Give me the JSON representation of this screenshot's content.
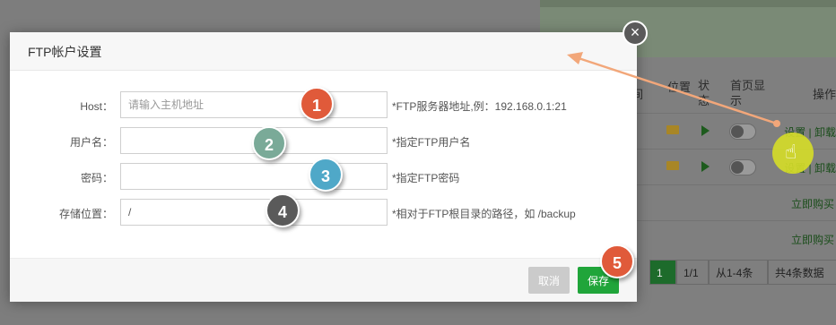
{
  "modal": {
    "title": "FTP帐户设置",
    "fields": [
      {
        "label": "Host：",
        "value": "",
        "placeholder": "请输入主机地址",
        "hint": "*FTP服务器地址,例：192.168.0.1:21"
      },
      {
        "label": "用户名：",
        "value": "",
        "placeholder": "",
        "hint": "*指定FTP用户名"
      },
      {
        "label": "密码：",
        "value": "",
        "placeholder": "",
        "hint": "*指定FTP密码"
      },
      {
        "label": "存储位置：",
        "value": "/",
        "placeholder": "",
        "hint": "*相对于FTP根目录的路径，如 /backup"
      }
    ],
    "cancel_label": "取消",
    "save_label": "保存",
    "close_icon": "×"
  },
  "badges": [
    {
      "number": "1",
      "color": "#e05a3a"
    },
    {
      "number": "2",
      "color": "#7aaa98"
    },
    {
      "number": "3",
      "color": "#4fa8c8"
    },
    {
      "number": "4",
      "color": "#5a5a5a"
    },
    {
      "number": "5",
      "color": "#e05a3a"
    }
  ],
  "background": {
    "columns": [
      "间",
      "位置",
      "状态",
      "首页显示",
      "操作"
    ],
    "rows": [
      {
        "ops": "设置 | 卸载"
      },
      {
        "ops": "设置 | 卸载"
      }
    ],
    "buy_links": [
      "立即购买",
      "立即购买"
    ],
    "pager": {
      "current": "1",
      "pages": "1/1",
      "range": "从1-4条",
      "total": "共4条数据"
    }
  },
  "colors": {
    "accent": "#20a53a",
    "arrow": "#f2a77a",
    "cursor_halo": "#d6de28"
  }
}
